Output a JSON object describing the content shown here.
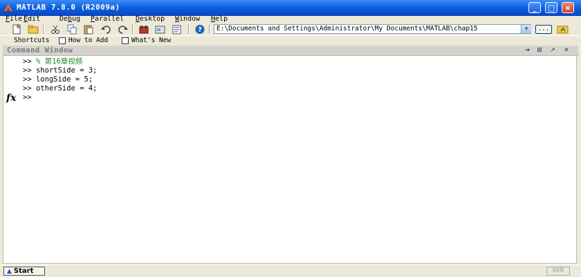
{
  "window": {
    "title": "MATLAB  7.8.0 (R2009a)",
    "minimize_glyph": "_",
    "maximize_glyph": "□",
    "close_glyph": "×"
  },
  "menu": [
    {
      "key": "F",
      "rest": "ile"
    },
    {
      "key": "E",
      "rest": "dit"
    },
    {
      "key": "",
      "pre": "De",
      "mid": "b",
      "rest": "ug"
    },
    {
      "key": "P",
      "rest": "arallel"
    },
    {
      "key": "D",
      "rest": "esktop"
    },
    {
      "key": "W",
      "rest": "indow"
    },
    {
      "key": "H",
      "rest": "elp"
    }
  ],
  "toolbar": {
    "current_folder": "E:\\Documents and Settings\\Administrator\\My Documents\\MATLAB\\chap15",
    "browse_label": "..."
  },
  "shortcuts": {
    "shortcuts_label": "Shortcuts",
    "how_to_add_label": "How to Add",
    "whats_new_label": "What's New"
  },
  "command_window": {
    "title": "Command Window",
    "fx_label": "fx",
    "lines": [
      {
        "prompt": ">>",
        "text": "% 第16章视频",
        "comment": true
      },
      {
        "prompt": ">>",
        "text": "shortSide = 3;",
        "comment": false
      },
      {
        "prompt": ">>",
        "text": "longSide = 5;",
        "comment": false
      },
      {
        "prompt": ">>",
        "text": "otherSide = 4;",
        "comment": false
      },
      {
        "prompt": ">>",
        "text": "",
        "comment": false
      }
    ]
  },
  "statusbar": {
    "start_label": "Start",
    "ovr_label": "OVR"
  },
  "colors": {
    "titlebar": "#0a5ce0",
    "comment": "#228b22",
    "chrome": "#ece9d8"
  }
}
